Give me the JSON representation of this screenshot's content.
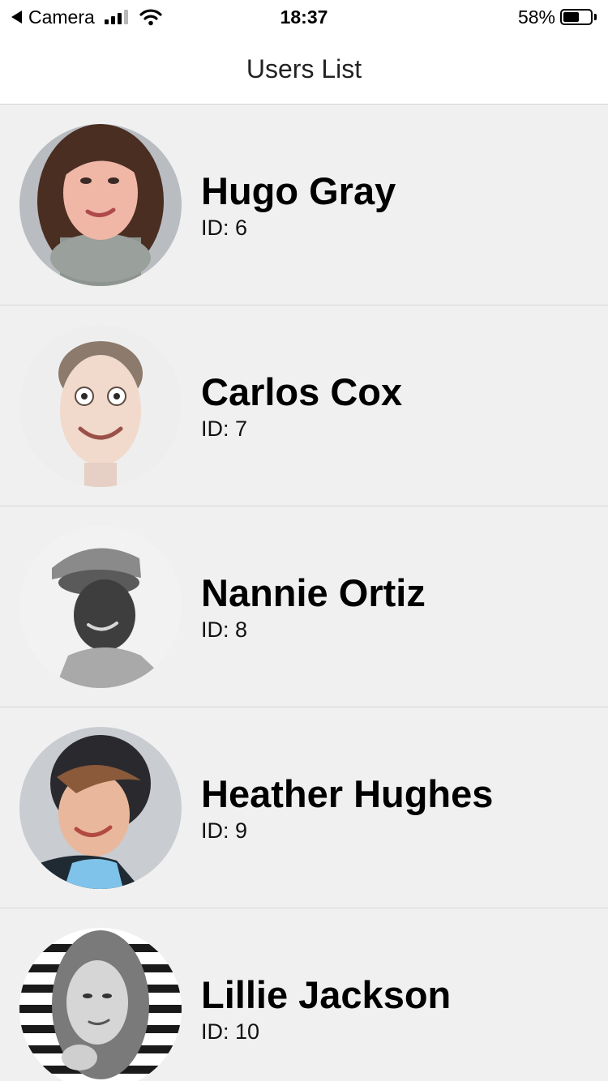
{
  "status_bar": {
    "back_app": "Camera",
    "time": "18:37",
    "battery_percent_text": "58%",
    "battery_level": 0.58
  },
  "nav": {
    "title": "Users List"
  },
  "users": [
    {
      "name": "Hugo Gray",
      "id_text": "ID: 6",
      "avatar_icon": "avatar-photo"
    },
    {
      "name": "Carlos Cox",
      "id_text": "ID: 7",
      "avatar_icon": "avatar-photo"
    },
    {
      "name": "Nannie Ortiz",
      "id_text": "ID: 8",
      "avatar_icon": "avatar-photo"
    },
    {
      "name": "Heather Hughes",
      "id_text": "ID: 9",
      "avatar_icon": "avatar-photo"
    },
    {
      "name": "Lillie Jackson",
      "id_text": "ID: 10",
      "avatar_icon": "avatar-photo"
    }
  ],
  "colors": {
    "list_background": "#f0f0f0",
    "header_background": "#ffffff",
    "separator": "#d8d8d8"
  }
}
